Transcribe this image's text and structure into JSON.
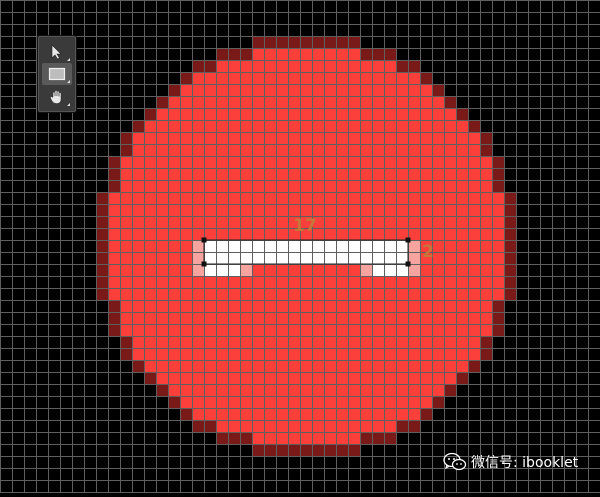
{
  "canvas": {
    "background": "#000000",
    "grid_color": "#5f5f5f",
    "circle_color": "#fb3f3a",
    "circle_edge_color": "#7a1a18",
    "shape_color": "#ffffff",
    "shape_edge_color": "#f7a3a0"
  },
  "toolbar": {
    "tools": [
      {
        "name": "direct-selection-tool",
        "icon": "arrow-cursor-icon"
      },
      {
        "name": "rectangle-tool",
        "icon": "rectangle-icon"
      },
      {
        "name": "hand-tool",
        "icon": "hand-icon"
      }
    ],
    "active_tool": "rectangle-tool"
  },
  "dimensions": {
    "width_label": "17",
    "height_label": "2"
  },
  "watermark": {
    "icon": "wechat-icon",
    "text": "微信号: ibooklet"
  }
}
